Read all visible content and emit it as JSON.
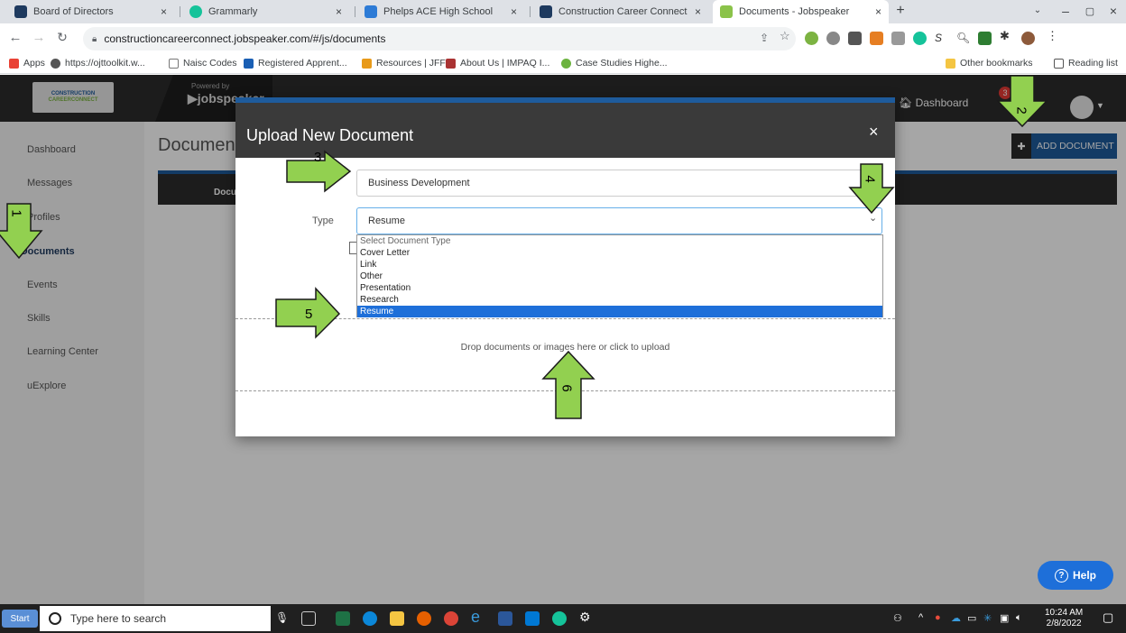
{
  "browser": {
    "tabs": [
      {
        "title": "Board of Directors",
        "color": "#1e3a5f"
      },
      {
        "title": "Grammarly",
        "color": "#15c39a"
      },
      {
        "title": "Phelps ACE High School",
        "color": "#2d7bd6"
      },
      {
        "title": "Construction Career Connect > H",
        "color": "#1e3a5f"
      },
      {
        "title": "Documents - Jobspeaker",
        "color": "#8bc34a"
      }
    ],
    "new_tab": "+",
    "url": "constructioncareerconnect.jobspeaker.com/#/js/documents",
    "bookmarks": [
      {
        "label": "Apps",
        "color": "#e94235"
      },
      {
        "label": "https://ojttoolkit.w...",
        "color": "#555555"
      },
      {
        "label": "Naisc Codes",
        "color": "#777777"
      },
      {
        "label": "Registered Apprent...",
        "color": "#1a5fb4"
      },
      {
        "label": "Resources | JFF",
        "color": "#e89a1a"
      },
      {
        "label": "About Us | IMPAQ I...",
        "color": "#a33"
      },
      {
        "label": "Case Studies Highe...",
        "color": "#6cb33f"
      }
    ],
    "other_bookmarks": "Other bookmarks",
    "reading_list": "Reading list"
  },
  "app": {
    "logo_line1": "CONSTRUCTION",
    "logo_line2": "CAREERCONNECT",
    "powered_by": "Powered by",
    "brand": "jobspeaker",
    "dashboard_link": "Dashboard",
    "notification_count": "3",
    "sidebar": [
      {
        "label": "Dashboard"
      },
      {
        "label": "Messages"
      },
      {
        "label": "Profiles"
      },
      {
        "label": "Documents",
        "active": true
      },
      {
        "label": "Events"
      },
      {
        "label": "Skills"
      },
      {
        "label": "Learning Center"
      },
      {
        "label": "uExplore"
      }
    ],
    "page_title": "Documents",
    "table_header_doc": "Document",
    "add_document": "ADD DOCUMENT",
    "help": "Help"
  },
  "dialog": {
    "title": "Upload New Document",
    "close": "×",
    "name_value": "Business Development",
    "type_label": "Type",
    "type_value": "Resume",
    "options": [
      "Select Document Type",
      "Cover Letter",
      "Link",
      "Other",
      "Presentation",
      "Research",
      "Resume"
    ],
    "selected_option": "Resume",
    "drop_text": "Drop documents or images here or click to upload"
  },
  "annotations": {
    "arrow_color": "#92d050",
    "labels": [
      "1",
      "2",
      "3",
      "4",
      "5",
      "6"
    ]
  },
  "taskbar": {
    "start": "Start",
    "search_placeholder": "Type here to search",
    "time": "10:24 AM",
    "date": "2/8/2022"
  }
}
